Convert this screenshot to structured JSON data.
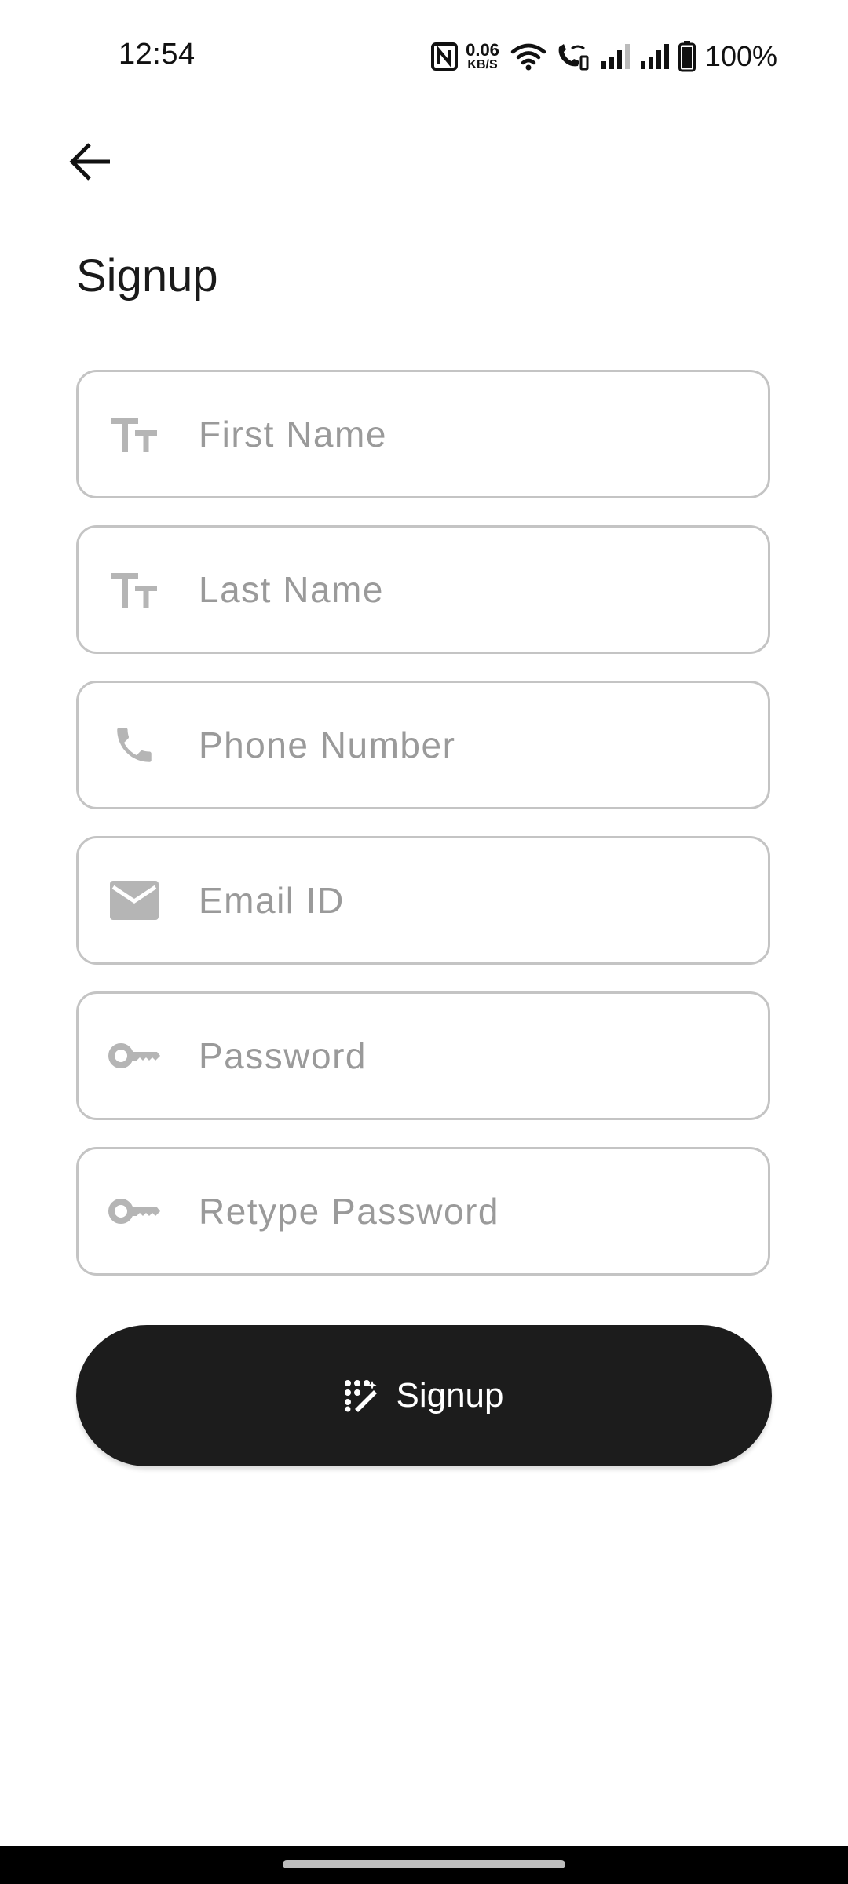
{
  "status_bar": {
    "time": "12:54",
    "net_speed_value": "0.06",
    "net_speed_unit": "KB/S",
    "battery_percent": "100%"
  },
  "header": {
    "title": "Signup"
  },
  "form": {
    "fields": [
      {
        "placeholder": "First Name",
        "icon": "text-size-icon"
      },
      {
        "placeholder": "Last Name",
        "icon": "text-size-icon"
      },
      {
        "placeholder": "Phone Number",
        "icon": "phone-icon"
      },
      {
        "placeholder": "Email ID",
        "icon": "email-icon"
      },
      {
        "placeholder": "Password",
        "icon": "key-icon"
      },
      {
        "placeholder": "Retype Password",
        "icon": "key-icon"
      }
    ],
    "submit_label": "Signup",
    "submit_icon": "magic-wand-icon"
  },
  "colors": {
    "button_bg": "#1c1c1c",
    "field_border": "#c4c4c4",
    "placeholder": "#9a9a9a",
    "icon_gray": "#b5b5b5"
  }
}
